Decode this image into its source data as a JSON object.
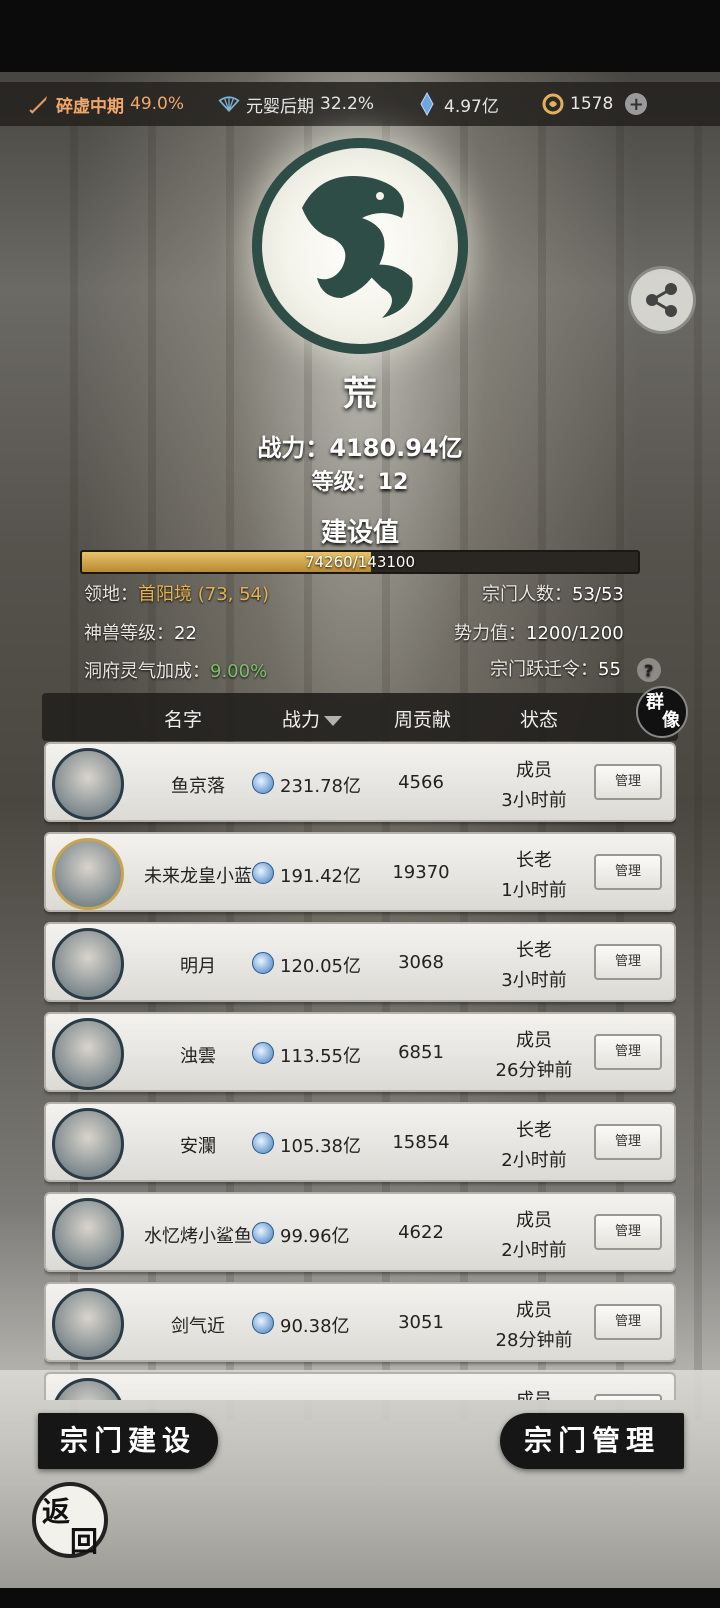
{
  "status_bar": {
    "cultivation1": {
      "label": "碎虚中期",
      "percent": "49.0%",
      "icon": "sword-icon"
    },
    "cultivation2": {
      "label": "元婴后期",
      "percent": "32.2%",
      "icon": "fan-icon"
    },
    "spirit_stones": {
      "value": "4.97亿",
      "icon": "crystal-icon"
    },
    "coins": {
      "value": "1578",
      "icon": "coin-icon"
    }
  },
  "sect": {
    "name": "荒",
    "power_label": "战力：",
    "power_value": "4180.94亿",
    "level_label": "等级：",
    "level_value": "12",
    "build_title": "建设值",
    "build_text": "74260/143100",
    "build_progress": 0.519
  },
  "info": {
    "territory_label": "领地：",
    "territory_value": "首阳境",
    "territory_coords": "(73, 54)",
    "members_label": "宗门人数：",
    "members_value": "53/53",
    "beast_label": "神兽等级：",
    "beast_value": "22",
    "influence_label": "势力值：",
    "influence_value": "1200/1200",
    "cave_label": "洞府灵气加成：",
    "cave_value": "9.00%",
    "migrate_label": "宗门跃迁令：",
    "migrate_value": "55",
    "help": "?"
  },
  "table": {
    "col_name": "名字",
    "col_power": "战力",
    "col_contrib": "周贡献",
    "col_status": "状态",
    "portrait_label_1": "群",
    "portrait_label_2": "像",
    "manage_label": "管理",
    "rows": [
      {
        "name": "鱼京落",
        "power": "231.78亿",
        "contrib": "4566",
        "role": "成员",
        "time": "3小时前"
      },
      {
        "name": "未来龙皇小蓝",
        "power": "191.42亿",
        "contrib": "19370",
        "role": "长老",
        "time": "1小时前"
      },
      {
        "name": "明月",
        "power": "120.05亿",
        "contrib": "3068",
        "role": "长老",
        "time": "3小时前"
      },
      {
        "name": "浊雲",
        "power": "113.55亿",
        "contrib": "6851",
        "role": "成员",
        "time": "26分钟前"
      },
      {
        "name": "安瀾",
        "power": "105.38亿",
        "contrib": "15854",
        "role": "长老",
        "time": "2小时前"
      },
      {
        "name": "水忆烤小鲨鱼",
        "power": "99.96亿",
        "contrib": "4622",
        "role": "成员",
        "time": "2小时前"
      },
      {
        "name": "剑气近",
        "power": "90.38亿",
        "contrib": "3051",
        "role": "成员",
        "time": "28分钟前"
      },
      {
        "name": "",
        "power": "",
        "contrib": "",
        "role": "成员",
        "time": ""
      }
    ]
  },
  "buttons": {
    "build": "宗门建设",
    "manage": "宗门管理",
    "back_1": "返",
    "back_2": "回"
  }
}
